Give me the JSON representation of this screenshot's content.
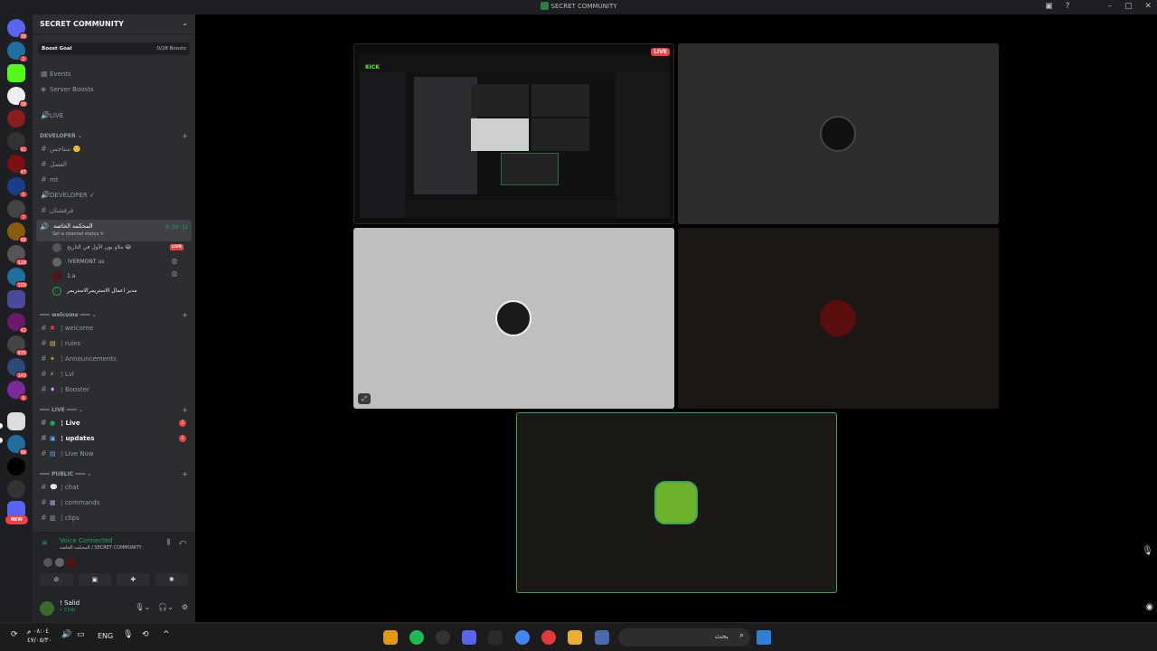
{
  "window": {
    "title": "SECRET COMMUNITY"
  },
  "server_badges": [
    "38",
    "2",
    "38",
    "91",
    "47",
    "5",
    "7",
    "68",
    "528",
    "109",
    "42",
    "635",
    "140",
    "6",
    "96"
  ],
  "server_new_label": "NEW",
  "guild": {
    "name": "SECRET COMMUNITY",
    "boost_goal_label": "Boost Goal",
    "boost_count": "0/28 Boosts"
  },
  "top_items": [
    {
      "label": "Events",
      "icon": "calendar-icon"
    },
    {
      "label": "Server Boosts",
      "icon": "boost-icon"
    }
  ],
  "live_channel": "LIVE",
  "categories": {
    "developer": "DEVELOPER",
    "welcome": "welcome",
    "live": "LIVE",
    "public": "PUBLIC"
  },
  "developer_channels": [
    {
      "label": "سناجس 🙂"
    },
    {
      "label": "الفصل"
    },
    {
      "label": "mt"
    },
    {
      "label": "DEVELOPER ✓"
    },
    {
      "label": "فرفشتان"
    }
  ],
  "voice_channel": {
    "name": "المحكمه الخاصه",
    "status": "Set a channel status ✎",
    "timer": "3:38:32",
    "live_label": "LIVE",
    "users": [
      {
        "name": "ملاو بون الأول في التاريخ 😂"
      },
      {
        "name": "!VERMONT us"
      },
      {
        "name": "1.a"
      },
      {
        "name": "مدير اعمال الاستريمرالاستريمر"
      }
    ]
  },
  "welcome_channels": [
    {
      "label": "welcome",
      "emoji": "✖"
    },
    {
      "label": "rules",
      "emoji": "▤"
    },
    {
      "label": "Announcements",
      "emoji": "✦"
    },
    {
      "label": "Lvl",
      "emoji": "⚡"
    },
    {
      "label": "Booster",
      "emoji": "♦"
    }
  ],
  "live_channels": [
    {
      "label": "Live",
      "emoji": "●",
      "badge": "2"
    },
    {
      "label": "updates",
      "emoji": "▣",
      "badge": "1"
    },
    {
      "label": "Live Now",
      "emoji": "▤"
    }
  ],
  "public_channels": [
    {
      "label": "chat",
      "emoji": "💬"
    },
    {
      "label": "commands",
      "emoji": "▦"
    },
    {
      "label": "clips",
      "emoji": "▥"
    }
  ],
  "voice_panel": {
    "title": "Voice Connected",
    "subtitle": "المحكمه الخاصة / SECRET COMMUNITY"
  },
  "user": {
    "name": "! Salid",
    "status": "• Chill"
  },
  "stream_tile": {
    "live_label": "LIVE",
    "kick_label": "KICK"
  },
  "taskbar": {
    "clock_time": "٠٨:٠٤ م",
    "clock_date": "٤٧/٠٥/٣٠",
    "lang": "ENG",
    "search_placeholder": "بحث"
  },
  "colors": {
    "accent": "#23a55a",
    "danger": "#f23f43",
    "kick": "#53fc18"
  }
}
